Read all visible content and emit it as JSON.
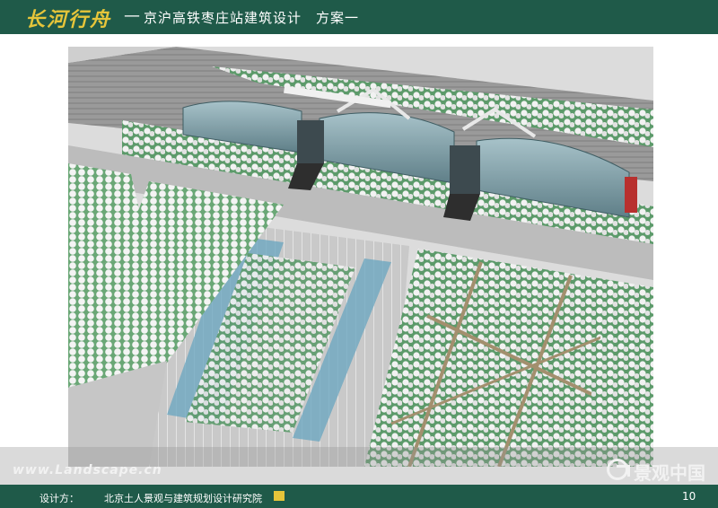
{
  "header": {
    "brand": "长河行舟",
    "separator": "—",
    "title": "京沪高铁枣庄站建筑设计",
    "scheme": "方案一"
  },
  "watermark": {
    "url": "www.Landscape.cn",
    "logo_text": "景观中国",
    "logo_icon": "landscape-china-logo-icon"
  },
  "footer": {
    "design_label": "设计方：",
    "design_org": "北京土人景观与建筑规划设计研究院",
    "badge_icon": "institute-badge-icon",
    "page_number": "10"
  },
  "colors": {
    "bar_green": "#1f5a49",
    "brand_gold": "#e6c53a",
    "lawn_green": "#4f9a62",
    "plaza_gray": "#bdbdbd",
    "glass_blue": "#7fa3ad"
  }
}
